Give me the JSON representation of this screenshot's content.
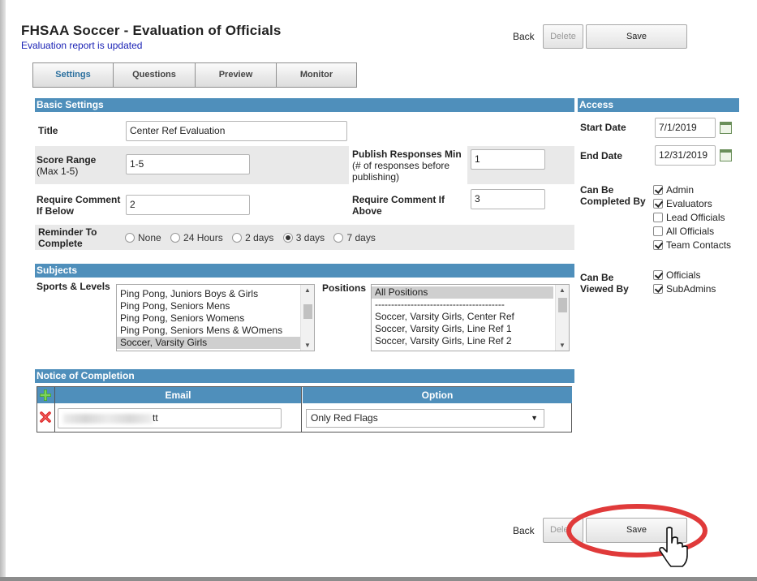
{
  "header": {
    "title": "FHSAA Soccer - Evaluation of Officials",
    "status": "Evaluation report is updated",
    "back": "Back",
    "delete": "Delete",
    "save": "Save"
  },
  "tabs": [
    {
      "label": "Settings",
      "active": true
    },
    {
      "label": "Questions"
    },
    {
      "label": "Preview"
    },
    {
      "label": "Monitor"
    }
  ],
  "basic": {
    "heading": "Basic Settings",
    "title_label": "Title",
    "title_value": "Center Ref Evaluation",
    "score_label": "Score Range",
    "score_sub": "(Max 1-5)",
    "score_value": "1-5",
    "publish_label": "Publish Responses Min",
    "publish_sub": "(# of responses before publishing)",
    "publish_value": "1",
    "req_below_label": "Require Comment If Below",
    "req_below_value": "2",
    "req_above_label": "Require Comment If Above",
    "req_above_value": "3",
    "reminder_label": "Reminder To Complete",
    "reminder_options": [
      "None",
      "24 Hours",
      "2 days",
      "3 days",
      "7 days"
    ],
    "reminder_selected": "3 days"
  },
  "subjects": {
    "heading": "Subjects",
    "sports_label": "Sports & Levels",
    "sports_items": [
      "Ping Pong, Juniors Boys & Girls",
      "Ping Pong, Seniors Mens",
      "Ping Pong, Seniors Womens",
      "Ping Pong, Seniors Mens & WOmens",
      "Soccer, Varsity Girls"
    ],
    "positions_label": "Positions",
    "positions_items": [
      "All Positions",
      "----------------------------------------",
      "Soccer, Varsity Girls, Center Ref",
      "Soccer, Varsity Girls, Line Ref 1",
      "Soccer, Varsity Girls, Line Ref 2"
    ]
  },
  "notice": {
    "heading": "Notice of Completion",
    "email_header": "Email",
    "option_header": "Option",
    "email_value_suffix": "tt",
    "option_value": "Only Red Flags"
  },
  "access": {
    "heading": "Access",
    "start_label": "Start Date",
    "start_value": "7/1/2019",
    "end_label": "End Date",
    "end_value": "12/31/2019",
    "completed_label": "Can Be Completed By",
    "completed_options": [
      {
        "label": "Admin",
        "checked": true
      },
      {
        "label": "Evaluators",
        "checked": true
      },
      {
        "label": "Lead Officials",
        "checked": false
      },
      {
        "label": "All Officials",
        "checked": false
      },
      {
        "label": "Team Contacts",
        "checked": true
      }
    ],
    "viewed_label": "Can Be Viewed By",
    "viewed_options": [
      {
        "label": "Officials",
        "checked": true
      },
      {
        "label": "SubAdmins",
        "checked": true
      }
    ]
  },
  "footer": {
    "back": "Back",
    "delete_partial": "Dele",
    "save": "Save"
  },
  "colors": {
    "section_header": "#4f8fbb",
    "status_text": "#1a22b5",
    "annotation_circle": "#e03a3a"
  }
}
